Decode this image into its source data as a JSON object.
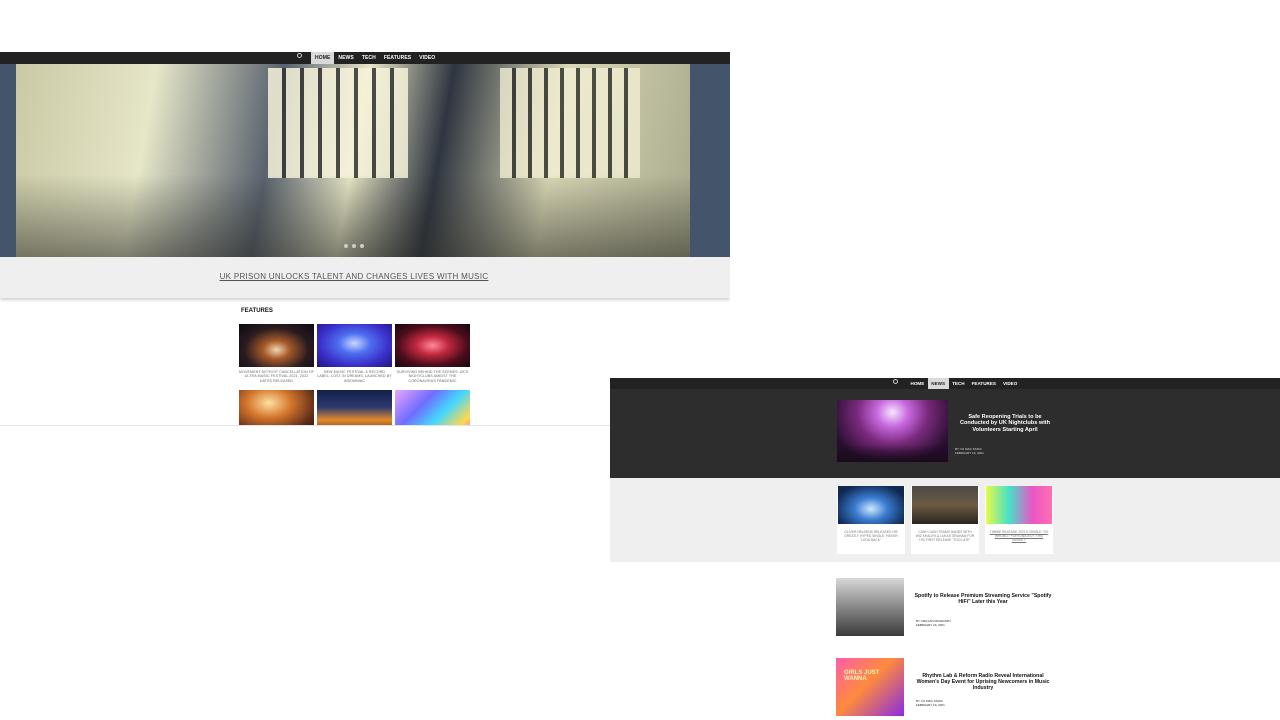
{
  "left_page": {
    "nav": {
      "logo": "logo-icon",
      "items": [
        {
          "label": "HOME",
          "active": true
        },
        {
          "label": "NEWS",
          "active": false
        },
        {
          "label": "TECH",
          "active": false
        },
        {
          "label": "FEATURES",
          "active": false
        },
        {
          "label": "VIDEO",
          "active": false
        }
      ]
    },
    "hero": {
      "headline": "UK PRISON UNLOCKS TALENT AND CHANGES LIVES WITH MUSIC",
      "carousel_dots": 3
    },
    "features": {
      "title": "FEATURES",
      "items": [
        {
          "caption": "MOVEMENT DETROIT CANCELLATION OF ULTRA MUSIC FESTIVAL 2021, 2022 DATES RELEASED"
        },
        {
          "caption": "NEW MUSIC FESTIVAL & RECORD LABEL, LOST IN DREAMS, LAUNCHED BY INSOMNIAC"
        },
        {
          "caption": "SURVIVING BEHIND THE SCENES: UK'S NIGHTCLUBS AMIDST THE CORONAVIRUS PANDEMIC"
        },
        {
          "caption": ""
        },
        {
          "caption": ""
        },
        {
          "caption": ""
        }
      ]
    }
  },
  "right_page": {
    "nav": {
      "logo": "logo-icon",
      "items": [
        {
          "label": "HOME",
          "active": false
        },
        {
          "label": "NEWS",
          "active": true
        },
        {
          "label": "TECH",
          "active": false
        },
        {
          "label": "FEATURES",
          "active": false
        },
        {
          "label": "VIDEO",
          "active": false
        }
      ]
    },
    "top_story": {
      "title": "Safe Reopening Trials to be Conducted by UK Nightclubs with Volunteers Starting April",
      "byline": "BY: DJ MAG STAFF",
      "date": "FEBRUARY 16, 2021"
    },
    "cards": [
      {
        "caption": "OLIVER HELDENS RELEASED HIS GREATLY HYPED SINGLE \"NEVER LOOK BACK\"",
        "underlined": false
      },
      {
        "caption": "CASH CASH TEAMS HANDS WITH WIZ KHALIFA & LUKAS GRAHAM FOR HIS FIRST RELEASE \"TOO LATE\"",
        "underlined": false
      },
      {
        "caption": "TIMMIE RELEASE 2021'S SINGLE \"SO WRONG / FORTUNATELY, THIS SUNSET\"",
        "underlined": true
      }
    ],
    "articles": [
      {
        "title": "Spotify to Release Premium Streaming Service \"Spotify HiFi\" Later this Year",
        "byline": "BY: DECLAN MCKEOWN",
        "date": "FEBRUARY 23, 2021"
      },
      {
        "title": "Rhythm Lab & Reform Radio Reveal International Women's Day Event for Uprising Newcomers in Music Industry",
        "byline": "BY: DJ MAG STAFF",
        "date": "FEBRUARY 19, 2021",
        "image_text": "GIRLS JUST WANNA"
      }
    ]
  }
}
